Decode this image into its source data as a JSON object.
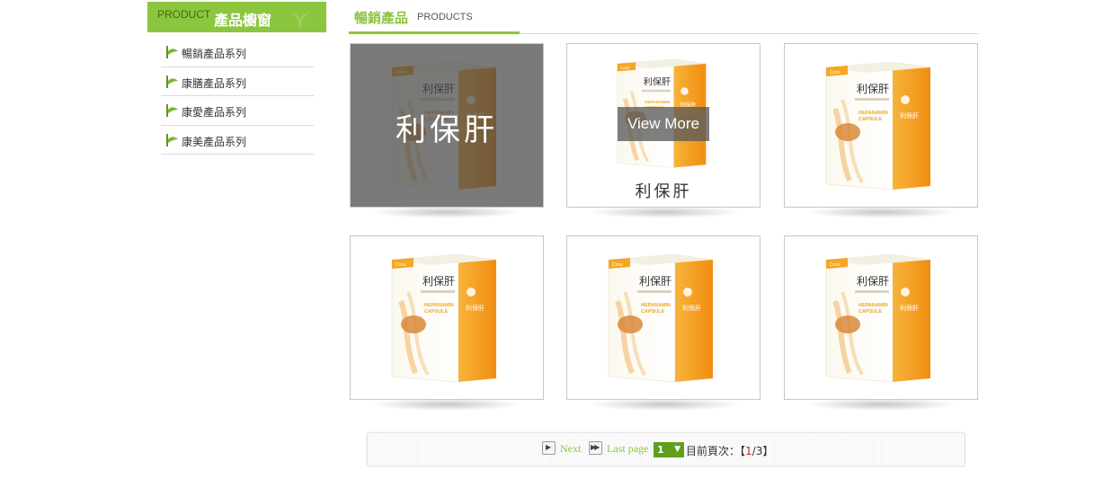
{
  "sidebar": {
    "header_en": "PRODUCT",
    "header_zh": "產品櫥窗",
    "items": [
      {
        "label": "暢銷產品系列"
      },
      {
        "label": "康膳產品系列"
      },
      {
        "label": "康愛產品系列"
      },
      {
        "label": "康美產品系列"
      }
    ]
  },
  "main": {
    "title_zh": "暢銷產品",
    "title_en": "PRODUCTS",
    "products": [
      {
        "name": "利保肝",
        "state": "hover-overlay"
      },
      {
        "name": "利保肝",
        "state": "view-more",
        "view_more": "View More"
      },
      {
        "name": "利保肝",
        "state": "normal"
      },
      {
        "name": "利保肝",
        "state": "normal"
      },
      {
        "name": "利保肝",
        "state": "normal"
      },
      {
        "name": "利保肝",
        "state": "normal"
      }
    ],
    "product_box": {
      "brand": "Cons",
      "name": "利保肝",
      "line1": "HEPANAMIN",
      "line2": "CAPSULE"
    }
  },
  "pagination": {
    "next": "Next",
    "last_page": "Last page",
    "selected_page": "1",
    "info_prefix": "目前頁次：【",
    "current": "1",
    "separator": "/",
    "total": "3",
    "info_suffix": "】"
  },
  "colors": {
    "accent": "#8cc63f",
    "box_orange": "#f5a623",
    "select_bg": "#5f9f1e",
    "current_page": "#cc2222"
  }
}
